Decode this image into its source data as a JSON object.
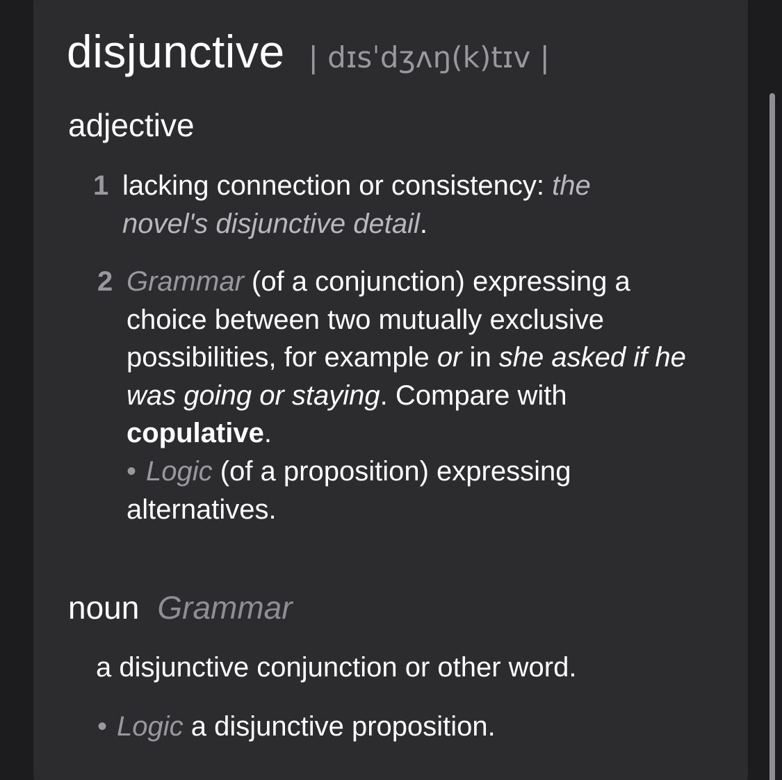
{
  "entry": {
    "headword": "disjunctive",
    "pronunciation": "| dɪsˈdʒʌŋ(k)tɪv |"
  },
  "adjective": {
    "pos_label": "adjective",
    "sense1": {
      "number": "1",
      "definition": "lacking connection or consistency: ",
      "example": "the novel's disjunctive detail",
      "end": "."
    },
    "sense2": {
      "number": "2",
      "subject": "Grammar",
      "definition": " (of a conjunction) expressing a choice between two mutually exclusive possibilities, for example ",
      "example_word": "or",
      "in_text": " in ",
      "example_sentence": "she asked if he was going or staying",
      "compare_text": ". Compare with ",
      "compare_word": "copulative",
      "end": "."
    },
    "subsense": {
      "bullet": "•",
      "subject": "Logic",
      "definition": " (of a proposition) expressing alternatives."
    }
  },
  "noun": {
    "pos_label": "noun",
    "subject": "Grammar",
    "definition": "a disjunctive conjunction or other word.",
    "subsense": {
      "bullet": "•",
      "subject": "Logic",
      "definition": " a disjunctive proposition."
    }
  }
}
